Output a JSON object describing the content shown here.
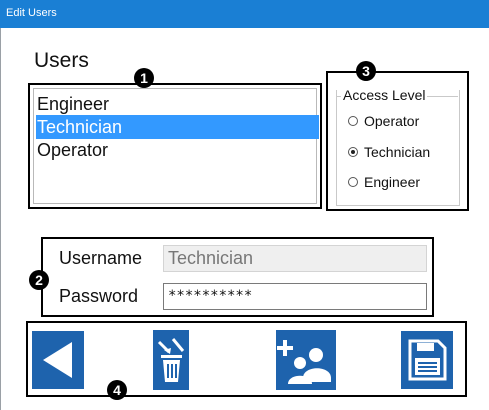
{
  "window": {
    "title": "Edit Users"
  },
  "users": {
    "label": "Users",
    "items": [
      {
        "label": "Engineer",
        "selected": false
      },
      {
        "label": "Technician",
        "selected": true
      },
      {
        "label": "Operator",
        "selected": false
      }
    ]
  },
  "access_level": {
    "legend": "Access Level",
    "options": [
      {
        "label": "Operator",
        "checked": false
      },
      {
        "label": "Technician",
        "checked": true
      },
      {
        "label": "Engineer",
        "checked": false
      }
    ]
  },
  "credentials": {
    "username_label": "Username",
    "username_value": "Technician",
    "password_label": "Password",
    "password_value": "**********"
  },
  "toolbar": {
    "buttons": [
      {
        "icon": "back-arrow-icon"
      },
      {
        "icon": "delete-user-icon"
      },
      {
        "icon": "add-user-icon"
      },
      {
        "icon": "save-icon"
      }
    ],
    "color": "#1e63ad"
  },
  "markers": {
    "m1": "1",
    "m2": "2",
    "m3": "3",
    "m4": "4"
  },
  "colors": {
    "titlebar": "#1a7fd4",
    "selection": "#3399ff"
  }
}
